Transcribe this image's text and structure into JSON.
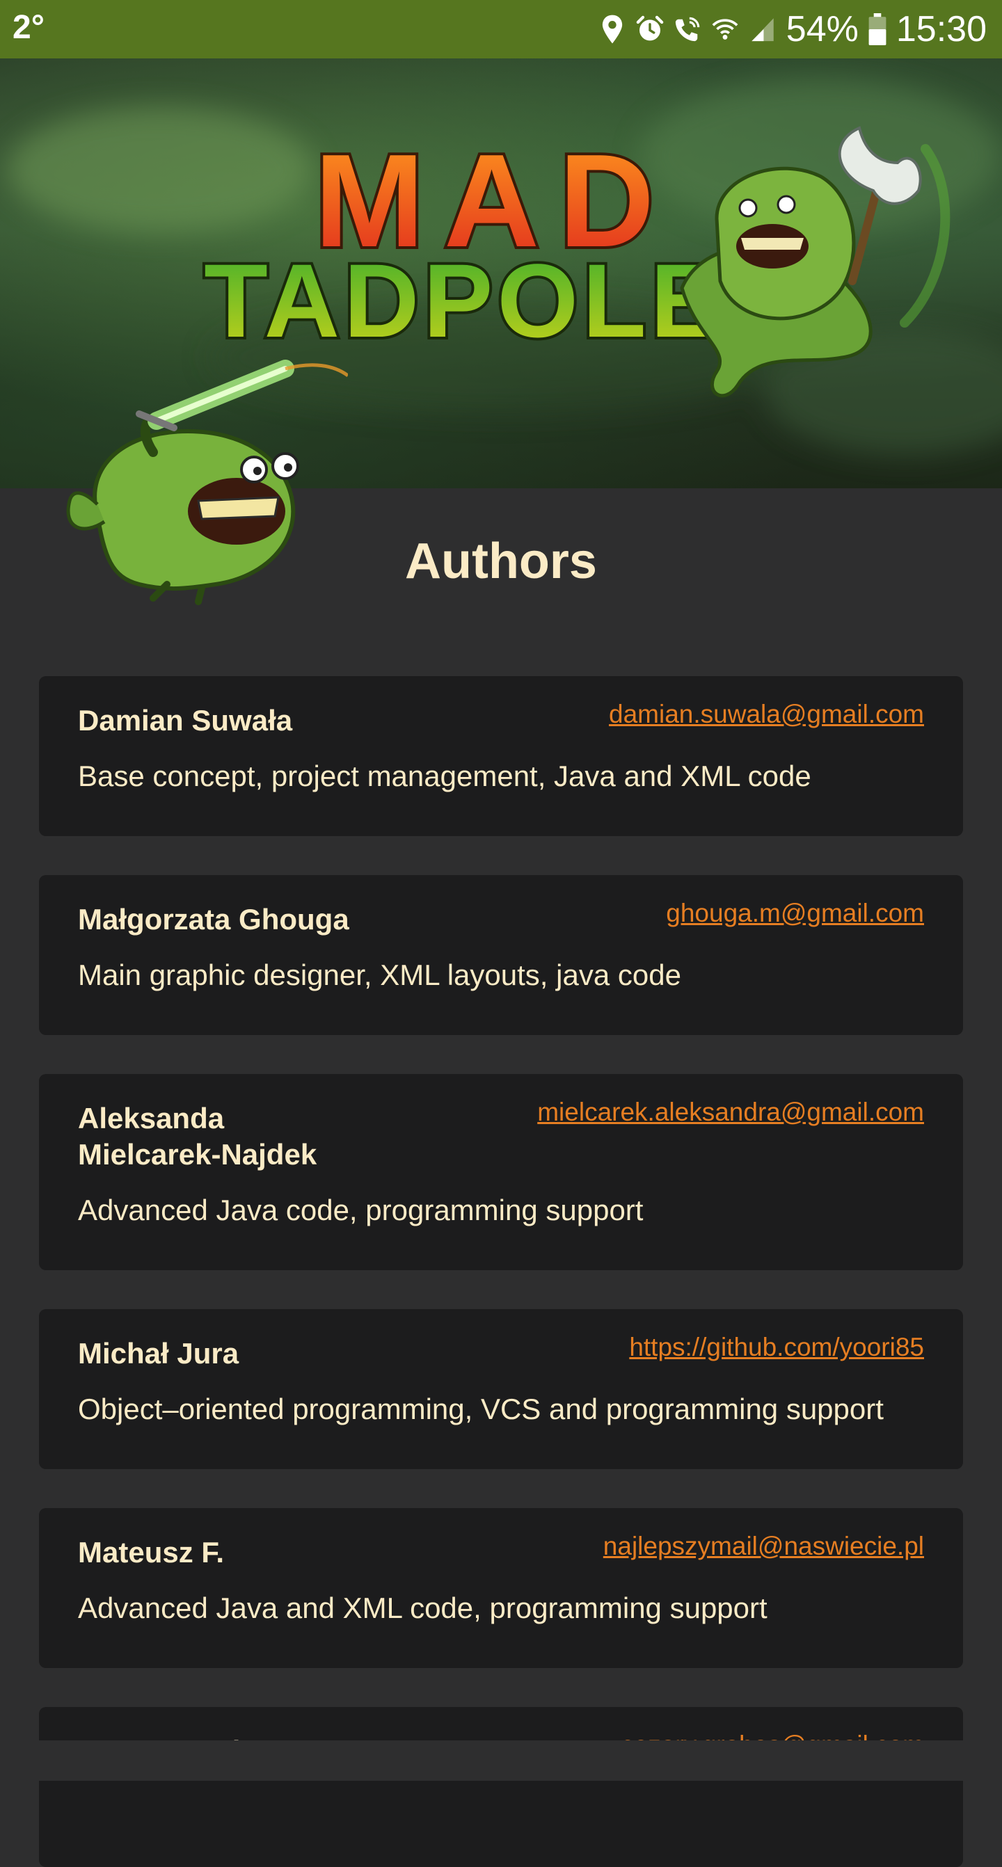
{
  "status_bar": {
    "temperature": "2°",
    "battery_percent": "54%",
    "time": "15:30",
    "icons": [
      "location-icon",
      "alarm-icon",
      "wifi-calling-icon",
      "wifi-icon",
      "cellular-signal-icon",
      "battery-icon"
    ],
    "background_color": "#56761f"
  },
  "hero": {
    "logo_line1": "MAD",
    "logo_line2": "TADPOLES"
  },
  "page_title": "Authors",
  "colors": {
    "background": "#2e2e2f",
    "card": "#1c1c1d",
    "text": "#fbebc6",
    "link": "#e67e22"
  },
  "authors": [
    {
      "name": "Damian Suwała",
      "contact": "damian.suwala@gmail.com",
      "role": "Base concept, project management, Java and XML code"
    },
    {
      "name": "Małgorzata Ghouga",
      "contact": "ghouga.m@gmail.com",
      "role": "Main graphic designer, XML layouts, java code"
    },
    {
      "name": "Aleksanda Mielcarek-Najdek",
      "contact": "mielcarek.aleksandra@gmail.com",
      "role": "Advanced Java code, programming support"
    },
    {
      "name": "Michał Jura",
      "contact": "https://github.com/yoori85",
      "role": "Object–oriented programming, VCS and programming support"
    },
    {
      "name": "Mateusz F.",
      "contact": "najlepszymail@naswiecie.pl",
      "role": "Advanced Java and XML code, programming support"
    },
    {
      "name": "Cezary Grabos",
      "contact": "cezary.grabos@gmail.com",
      "role": ""
    }
  ]
}
